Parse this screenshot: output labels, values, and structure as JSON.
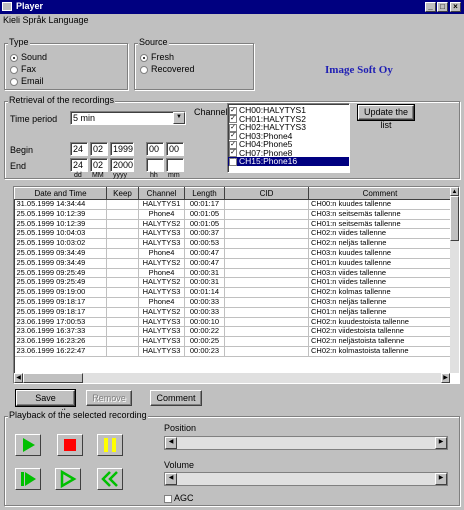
{
  "window": {
    "title": "Player"
  },
  "menu": {
    "label": "Kieli Språk Language"
  },
  "type_group": {
    "label": "Type",
    "options": [
      "Sound",
      "Fax",
      "Email"
    ],
    "selected": "Sound"
  },
  "source_group": {
    "label": "Source",
    "options": [
      "Fresh",
      "Recovered"
    ],
    "selected": "Fresh"
  },
  "brand": {
    "text": "Image Soft Oy",
    "color": "#1f1fb4"
  },
  "retrieval": {
    "label": "Retrieval of the recordings",
    "time_period_label": "Time period",
    "time_period_value": "5 min",
    "begin_label": "Begin",
    "end_label": "End",
    "begin": {
      "dd": "24",
      "mm": "02",
      "yyyy": "1999",
      "hh": "00",
      "min": "00"
    },
    "end": {
      "dd": "24",
      "mm": "02",
      "yyyy": "2000",
      "hh": "",
      "min": ""
    },
    "units": {
      "dd": "dd",
      "mm": "MM",
      "yyyy": "yyyy",
      "hh": "hh",
      "min": "mm"
    },
    "channels_label": "Channels",
    "channels": [
      {
        "name": "CH00:HALYTYS1",
        "checked": true,
        "selected": false
      },
      {
        "name": "CH01:HALYTYS2",
        "checked": true,
        "selected": false
      },
      {
        "name": "CH02:HALYTYS3",
        "checked": true,
        "selected": false
      },
      {
        "name": "CH03:Phone4",
        "checked": true,
        "selected": false
      },
      {
        "name": "CH04:Phone5",
        "checked": true,
        "selected": false
      },
      {
        "name": "CH07:Phone8",
        "checked": true,
        "selected": false
      },
      {
        "name": "CH15:Phone16",
        "checked": true,
        "selected": true
      }
    ],
    "update_button": "Update the list"
  },
  "table": {
    "columns": [
      "Date and Time",
      "Keep",
      "Channel",
      "Length",
      "CID",
      "Comment"
    ],
    "rows": [
      [
        "31.05.1999  14:34:44",
        "",
        "HALYTYS1",
        "00:01:17",
        "",
        "CH00:n kuudes tallenne"
      ],
      [
        "25.05.1999  10:12:39",
        "",
        "Phone4",
        "00:01:05",
        "",
        "CH03:n seitsemäs tallenne"
      ],
      [
        "25.05.1999  10:12:39",
        "",
        "HALYTYS2",
        "00:01:05",
        "",
        "CH01:n seitsemäs tallenne"
      ],
      [
        "25.05.1999  10:04:03",
        "",
        "HALYTYS3",
        "00:00:37",
        "",
        "CH02:n viides tallenne"
      ],
      [
        "25.05.1999  10:03:02",
        "",
        "HALYTYS3",
        "00:00:53",
        "",
        "CH02:n neljäs tallenne"
      ],
      [
        "25.05.1999  09:34:49",
        "",
        "Phone4",
        "00:00:47",
        "",
        "CH03:n kuudes tallenne"
      ],
      [
        "25.05.1999  09:34:49",
        "",
        "HALYTYS2",
        "00:00:47",
        "",
        "CH01:n kuudes tallenne"
      ],
      [
        "25.05.1999  09:25:49",
        "",
        "Phone4",
        "00:00:31",
        "",
        "CH03:n viides tallenne"
      ],
      [
        "25.05.1999  09:25:49",
        "",
        "HALYTYS2",
        "00:00:31",
        "",
        "CH01:n viides tallenne"
      ],
      [
        "25.05.1999  09:19:00",
        "",
        "HALYTYS3",
        "00:01:14",
        "",
        "CH02:n kolmas tallenne"
      ],
      [
        "25.05.1999  09:18:17",
        "",
        "Phone4",
        "00:00:33",
        "",
        "CH03:n neljäs tallenne"
      ],
      [
        "25.05.1999  09:18:17",
        "",
        "HALYTYS2",
        "00:00:33",
        "",
        "CH01:n neljäs tallenne"
      ],
      [
        "23.06.1999  17:00:53",
        "",
        "HALYTYS3",
        "00:00:10",
        "",
        "CH02:n kuudestoista tallenne"
      ],
      [
        "23.06.1999  16:37:33",
        "",
        "HALYTYS3",
        "00:00:22",
        "",
        "CH02:n viidestoista tallenne"
      ],
      [
        "23.06.1999  16:23:26",
        "",
        "HALYTYS3",
        "00:00:25",
        "",
        "CH02:n neljästoista tallenne"
      ],
      [
        "23.06.1999  16:22:47",
        "",
        "HALYTYS3",
        "00:00:23",
        "",
        "CH02:n kolmastoista tallenne"
      ]
    ]
  },
  "actions": {
    "save": "Save permanently",
    "remove": "Remove",
    "comment": "Comment"
  },
  "playback": {
    "label": "Playback of the selected recording",
    "position_label": "Position",
    "volume_label": "Volume",
    "agc_label": "AGC"
  },
  "colors": {
    "play": "#00c000",
    "stop": "#ff0000",
    "pause": "#ffff00",
    "selection": "#000080"
  }
}
